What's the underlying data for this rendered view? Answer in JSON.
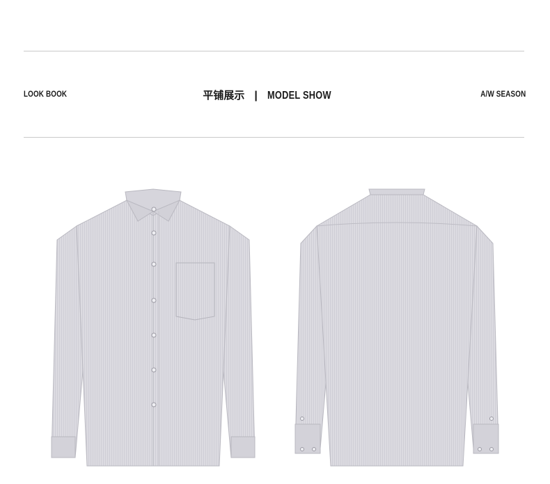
{
  "header": {
    "left_label": "LOOK BOOK",
    "center_cn": "平铺展示",
    "separator": "|",
    "center_en": "MODEL SHOW",
    "right_label": "A/W SEASON"
  },
  "colors": {
    "shirt_fill": "#d9d8de",
    "shirt_shade": "#c9c8cf",
    "shirt_outline": "#b9b8c0",
    "rule": "#c9c9c9"
  },
  "images": {
    "front": "shirt-front-image",
    "back": "shirt-back-image"
  }
}
